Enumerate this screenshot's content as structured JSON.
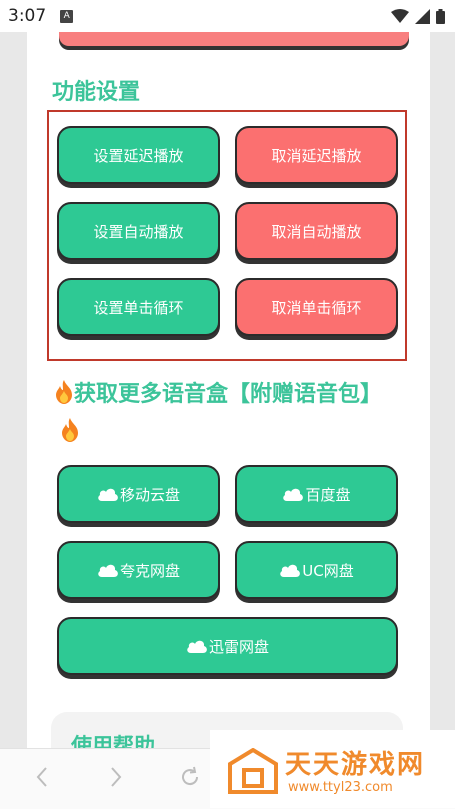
{
  "status_bar": {
    "time": "3:07",
    "sim_label": "A"
  },
  "settings": {
    "title": "功能设置",
    "buttons": [
      {
        "label": "设置延迟播放",
        "color": "#2ec994"
      },
      {
        "label": "取消延迟播放",
        "color": "#fb7070"
      },
      {
        "label": "设置自动播放",
        "color": "#2ec994"
      },
      {
        "label": "取消自动播放",
        "color": "#fb7070"
      },
      {
        "label": "设置单击循环",
        "color": "#2ec994"
      },
      {
        "label": "取消单击循环",
        "color": "#fb7070"
      }
    ]
  },
  "voicebox": {
    "heading": "获取更多语音盒【附赠语音包】",
    "icon": "fire-icon",
    "links": [
      {
        "label": "移动云盘",
        "icon": "cloud-icon"
      },
      {
        "label": "百度盘",
        "icon": "cloud-icon"
      },
      {
        "label": "夸克网盘",
        "icon": "cloud-icon"
      },
      {
        "label": "UC网盘",
        "icon": "cloud-icon"
      },
      {
        "label": "迅雷网盘",
        "icon": "cloud-icon"
      }
    ]
  },
  "help": {
    "title": "使用帮助"
  },
  "watermark": {
    "brand": "天天游戏网",
    "url": "www.ttyl23.com"
  },
  "colors": {
    "accent": "#3cc49a",
    "green_button": "#2ec994",
    "red_button": "#fb7070",
    "box_border": "#c0392b"
  }
}
